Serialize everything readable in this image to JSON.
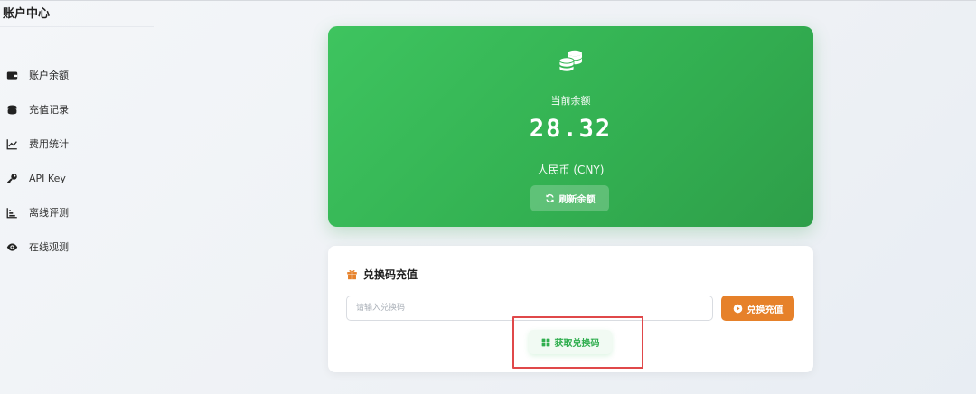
{
  "sidebar": {
    "title": "账户中心",
    "items": [
      {
        "label": "账户余额",
        "icon": "wallet-icon"
      },
      {
        "label": "充值记录",
        "icon": "coins-icon"
      },
      {
        "label": "费用统计",
        "icon": "line-chart-icon"
      },
      {
        "label": "API Key",
        "icon": "key-icon"
      },
      {
        "label": "离线评测",
        "icon": "bar-chart-icon"
      },
      {
        "label": "在线观测",
        "icon": "eye-icon"
      }
    ]
  },
  "balance": {
    "label": "当前余额",
    "amount": "28.32",
    "currency": "人民币 (CNY)",
    "refresh_label": "刷新余额",
    "icon": "coins-icon"
  },
  "redeem": {
    "title": "兑换码充值",
    "title_icon": "gift-icon",
    "input_placeholder": "请输入兑换码",
    "input_value": "",
    "redeem_label": "兑换充值",
    "get_code_label": "获取兑换码"
  },
  "colors": {
    "green": "#3ec45f",
    "orange": "#e6812a",
    "highlight": "#e0484a"
  }
}
